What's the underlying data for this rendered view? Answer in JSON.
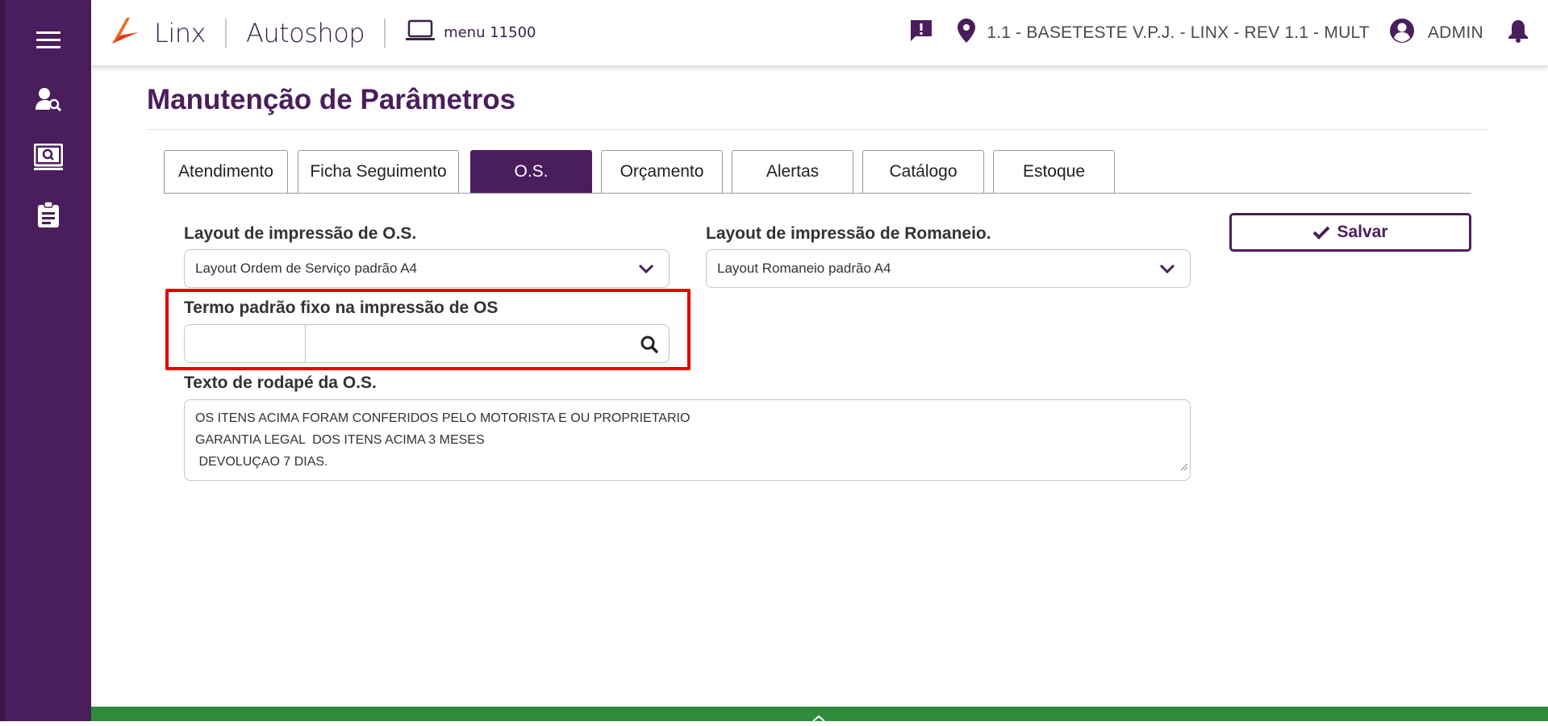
{
  "colors": {
    "brand": "#4a1d5c",
    "highlight": "#e60000",
    "footer": "#2e8b3a"
  },
  "sidebar": {
    "icons": [
      "hamburger-menu-icon",
      "user-search-icon",
      "monitor-search-icon",
      "clipboard-icon"
    ]
  },
  "header": {
    "brand": "Linx",
    "product": "Autoshop",
    "menu_label": "menu 11500",
    "location": "1.1 - BASETESTE V.P.J. - LINX - REV 1.1 - MULT",
    "user": "ADMIN",
    "icons": [
      "message-alert-icon",
      "map-pin-icon",
      "user-circle-icon",
      "bell-icon"
    ]
  },
  "page": {
    "title": "Manutenção de Parâmetros"
  },
  "tabs": [
    {
      "label": "Atendimento",
      "active": false
    },
    {
      "label": "Ficha Seguimento",
      "active": false
    },
    {
      "label": "O.S.",
      "active": true
    },
    {
      "label": "Orçamento",
      "active": false
    },
    {
      "label": "Alertas",
      "active": false
    },
    {
      "label": "Catálogo",
      "active": false
    },
    {
      "label": "Estoque",
      "active": false
    }
  ],
  "form": {
    "layout_os_label": "Layout de impressão de O.S.",
    "layout_os_value": "Layout Ordem de Serviço padrão A4",
    "layout_romaneio_label": "Layout de impressão de Romaneio.",
    "layout_romaneio_value": "Layout Romaneio padrão A4",
    "termo_label": "Termo padrão fixo na impressão de OS",
    "termo_code": "",
    "termo_description": "",
    "rodape_label": "Texto de rodapé da O.S.",
    "rodape_lines": [
      "OS ITENS ACIMA FORAM CONFERIDOS PELO MOTORISTA E OU PROPRIETARIO",
      "GARANTIA LEGAL  DOS ITENS ACIMA 3 MESES",
      " DEVOLUÇAO 7 DIAS."
    ]
  },
  "actions": {
    "save_label": "Salvar"
  }
}
